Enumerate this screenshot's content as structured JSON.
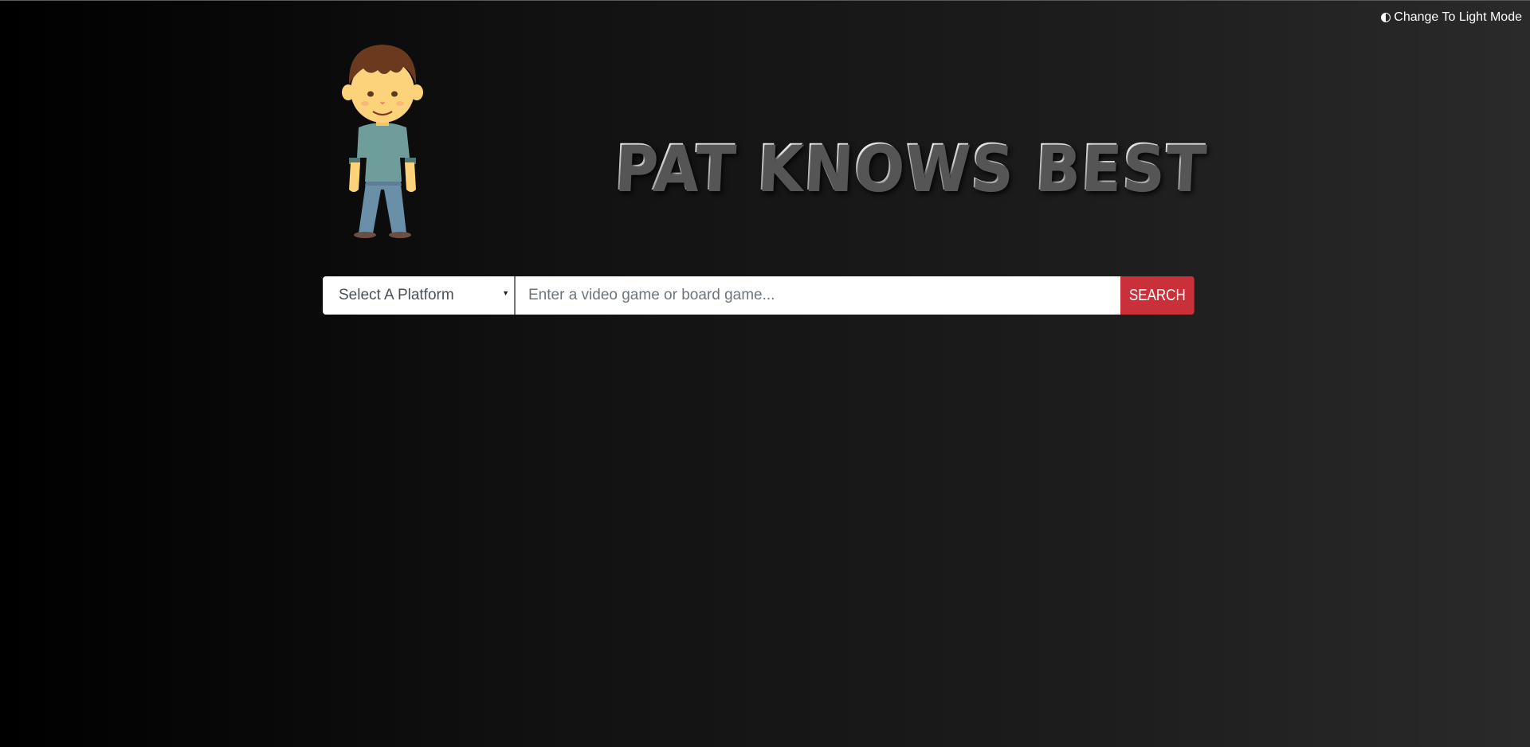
{
  "header": {
    "theme_toggle_label": "Change To Light Mode",
    "title": "PAT KNOWS BEST"
  },
  "search": {
    "platform_selected": "Select A Platform",
    "placeholder": "Enter a video game or board game...",
    "button_label": "SEARCH"
  },
  "colors": {
    "accent_button": "#c9303a",
    "background_start": "#000000",
    "background_end": "#2a2a2a"
  },
  "icons": {
    "theme_toggle": "contrast-icon",
    "select_caret": "caret-down-icon",
    "mascot": "mascot-boy-illustration"
  }
}
